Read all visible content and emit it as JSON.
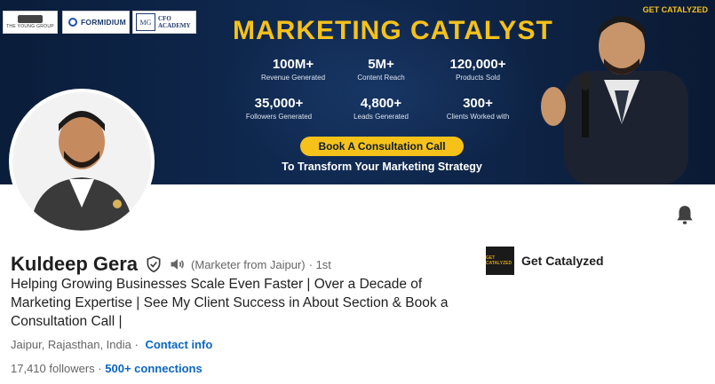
{
  "banner": {
    "logos": {
      "tyg": "THE YOUNG GROUP",
      "formidium": "FORMIDIUM",
      "cfo_mark": "MG",
      "cfo_line1": "CFO",
      "cfo_line2": "ACADEMY"
    },
    "brand": "GET CATALYZED",
    "title": "MARKETING CATALYST",
    "stats": [
      {
        "value": "100M+",
        "label": "Revenue Generated"
      },
      {
        "value": "5M+",
        "label": "Content Reach"
      },
      {
        "value": "120,000+",
        "label": "Products Sold"
      },
      {
        "value": "35,000+",
        "label": "Followers Generated"
      },
      {
        "value": "4,800+",
        "label": "Leads Generated"
      },
      {
        "value": "300+",
        "label": "Clients Worked with"
      }
    ],
    "cta": "Book A Consultation Call",
    "subtitle": "To Transform Your Marketing Strategy"
  },
  "profile": {
    "name": "Kuldeep Gera",
    "pronunciation": "(Marketer from Jaipur)",
    "degree": "· 1st",
    "headline": "Helping Growing Businesses Scale Even Faster | Over a Decade of Marketing Expertise | See My Client Success in About Section & Book a Consultation Call |",
    "location": "Jaipur, Rajasthan, India ·",
    "contact_info": "Contact info",
    "followers": "17,410 followers",
    "separator": "·",
    "connections": "500+ connections"
  },
  "company": {
    "name": "Get Catalyzed",
    "logo_text": "GET CATALYZED"
  },
  "colors": {
    "banner_bg": "#0f2547",
    "accent_yellow": "#f6c21a",
    "link_blue": "#0a66c2",
    "text_muted": "#666666"
  },
  "icons": [
    "verified-shield-icon",
    "audio-speaker-icon",
    "bell-icon"
  ]
}
